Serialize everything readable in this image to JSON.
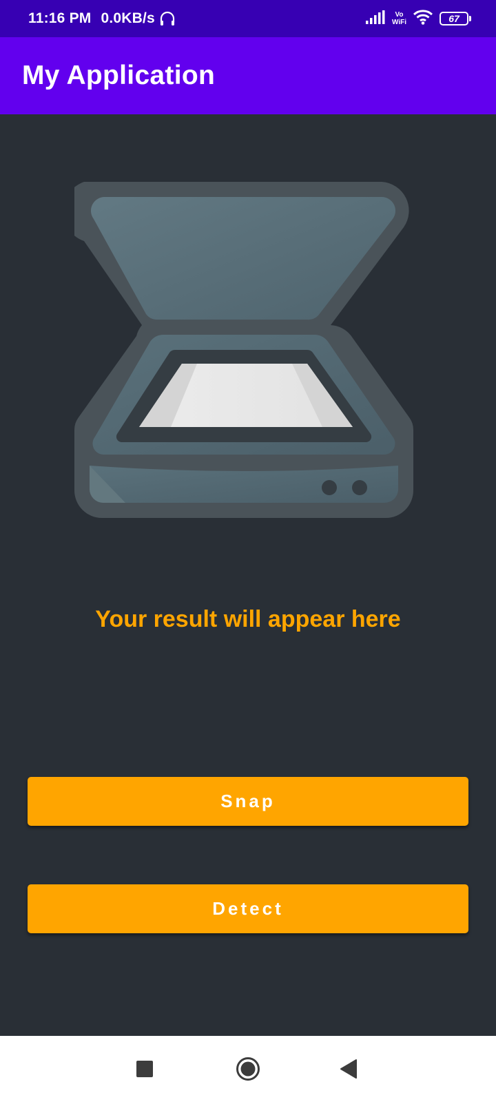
{
  "status_bar": {
    "time": "11:16 PM",
    "network_speed": "0.0KB/s",
    "vowifi_top": "Vo",
    "vowifi_bottom": "WiFi",
    "battery_level": "67",
    "icons": [
      "headset-icon",
      "signal-icon",
      "vowifi-icon",
      "wifi-icon",
      "battery-icon"
    ]
  },
  "app_bar": {
    "title": "My Application",
    "color": "#6200ee"
  },
  "main": {
    "illustration": "scanner-icon",
    "result_text": "Your result will appear here",
    "result_color": "#ffa500",
    "background": "#292f36"
  },
  "buttons": {
    "snap_label": "Snap",
    "detect_label": "Detect",
    "color": "#ffa500"
  },
  "nav_bar": {
    "icons": [
      "recents-icon",
      "home-icon",
      "back-icon"
    ]
  }
}
